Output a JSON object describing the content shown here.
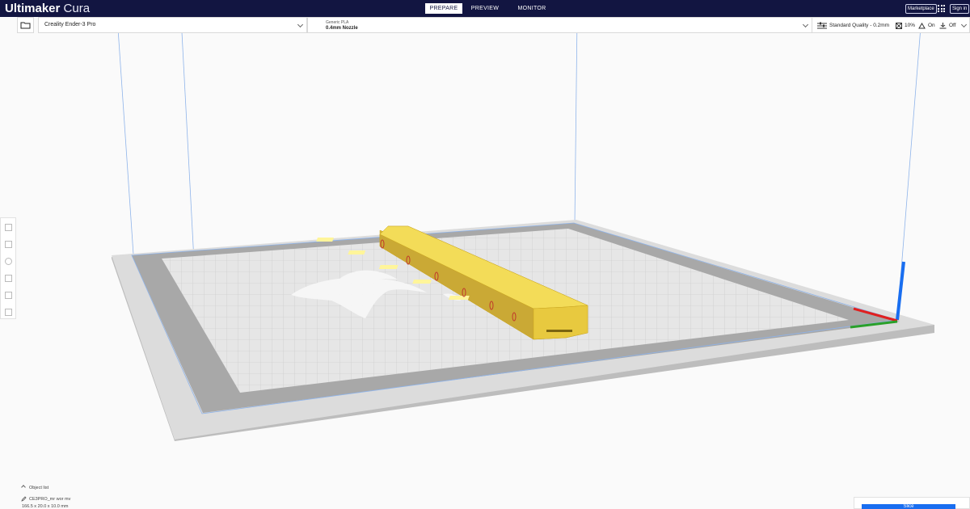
{
  "header": {
    "logo_brand": "Ultimaker",
    "logo_product": "Cura",
    "tabs": [
      {
        "label": "PREPARE",
        "active": true
      },
      {
        "label": "PREVIEW",
        "active": false
      },
      {
        "label": "MONITOR",
        "active": false
      }
    ],
    "marketplace_label": "Marketplace",
    "sign_in_label": "Sign in"
  },
  "toolbar": {
    "printer_name": "Creality Ender-3 Pro",
    "material": "Generic PLA",
    "nozzle": "0.4mm Nozzle",
    "quality": "Standard Quality - 0.2mm",
    "infill": "10%",
    "support": "On",
    "adhesion": "Off"
  },
  "left_tools": [
    {
      "name": "move-tool-icon"
    },
    {
      "name": "scale-tool-icon"
    },
    {
      "name": "rotate-tool-icon"
    },
    {
      "name": "mirror-tool-icon"
    },
    {
      "name": "per-model-settings-icon"
    },
    {
      "name": "support-blocker-icon"
    }
  ],
  "object_list": {
    "label": "Object list",
    "file_name": "CE3PRO_mr wor mv",
    "dimensions": "166.5 x 20.0 x 10.0 mm"
  },
  "slice": {
    "button_label": "Slice"
  },
  "colors": {
    "header_bg": "#121541",
    "accent": "#196ef0",
    "model": "#f5d547",
    "bed": "#d6d6d6"
  }
}
